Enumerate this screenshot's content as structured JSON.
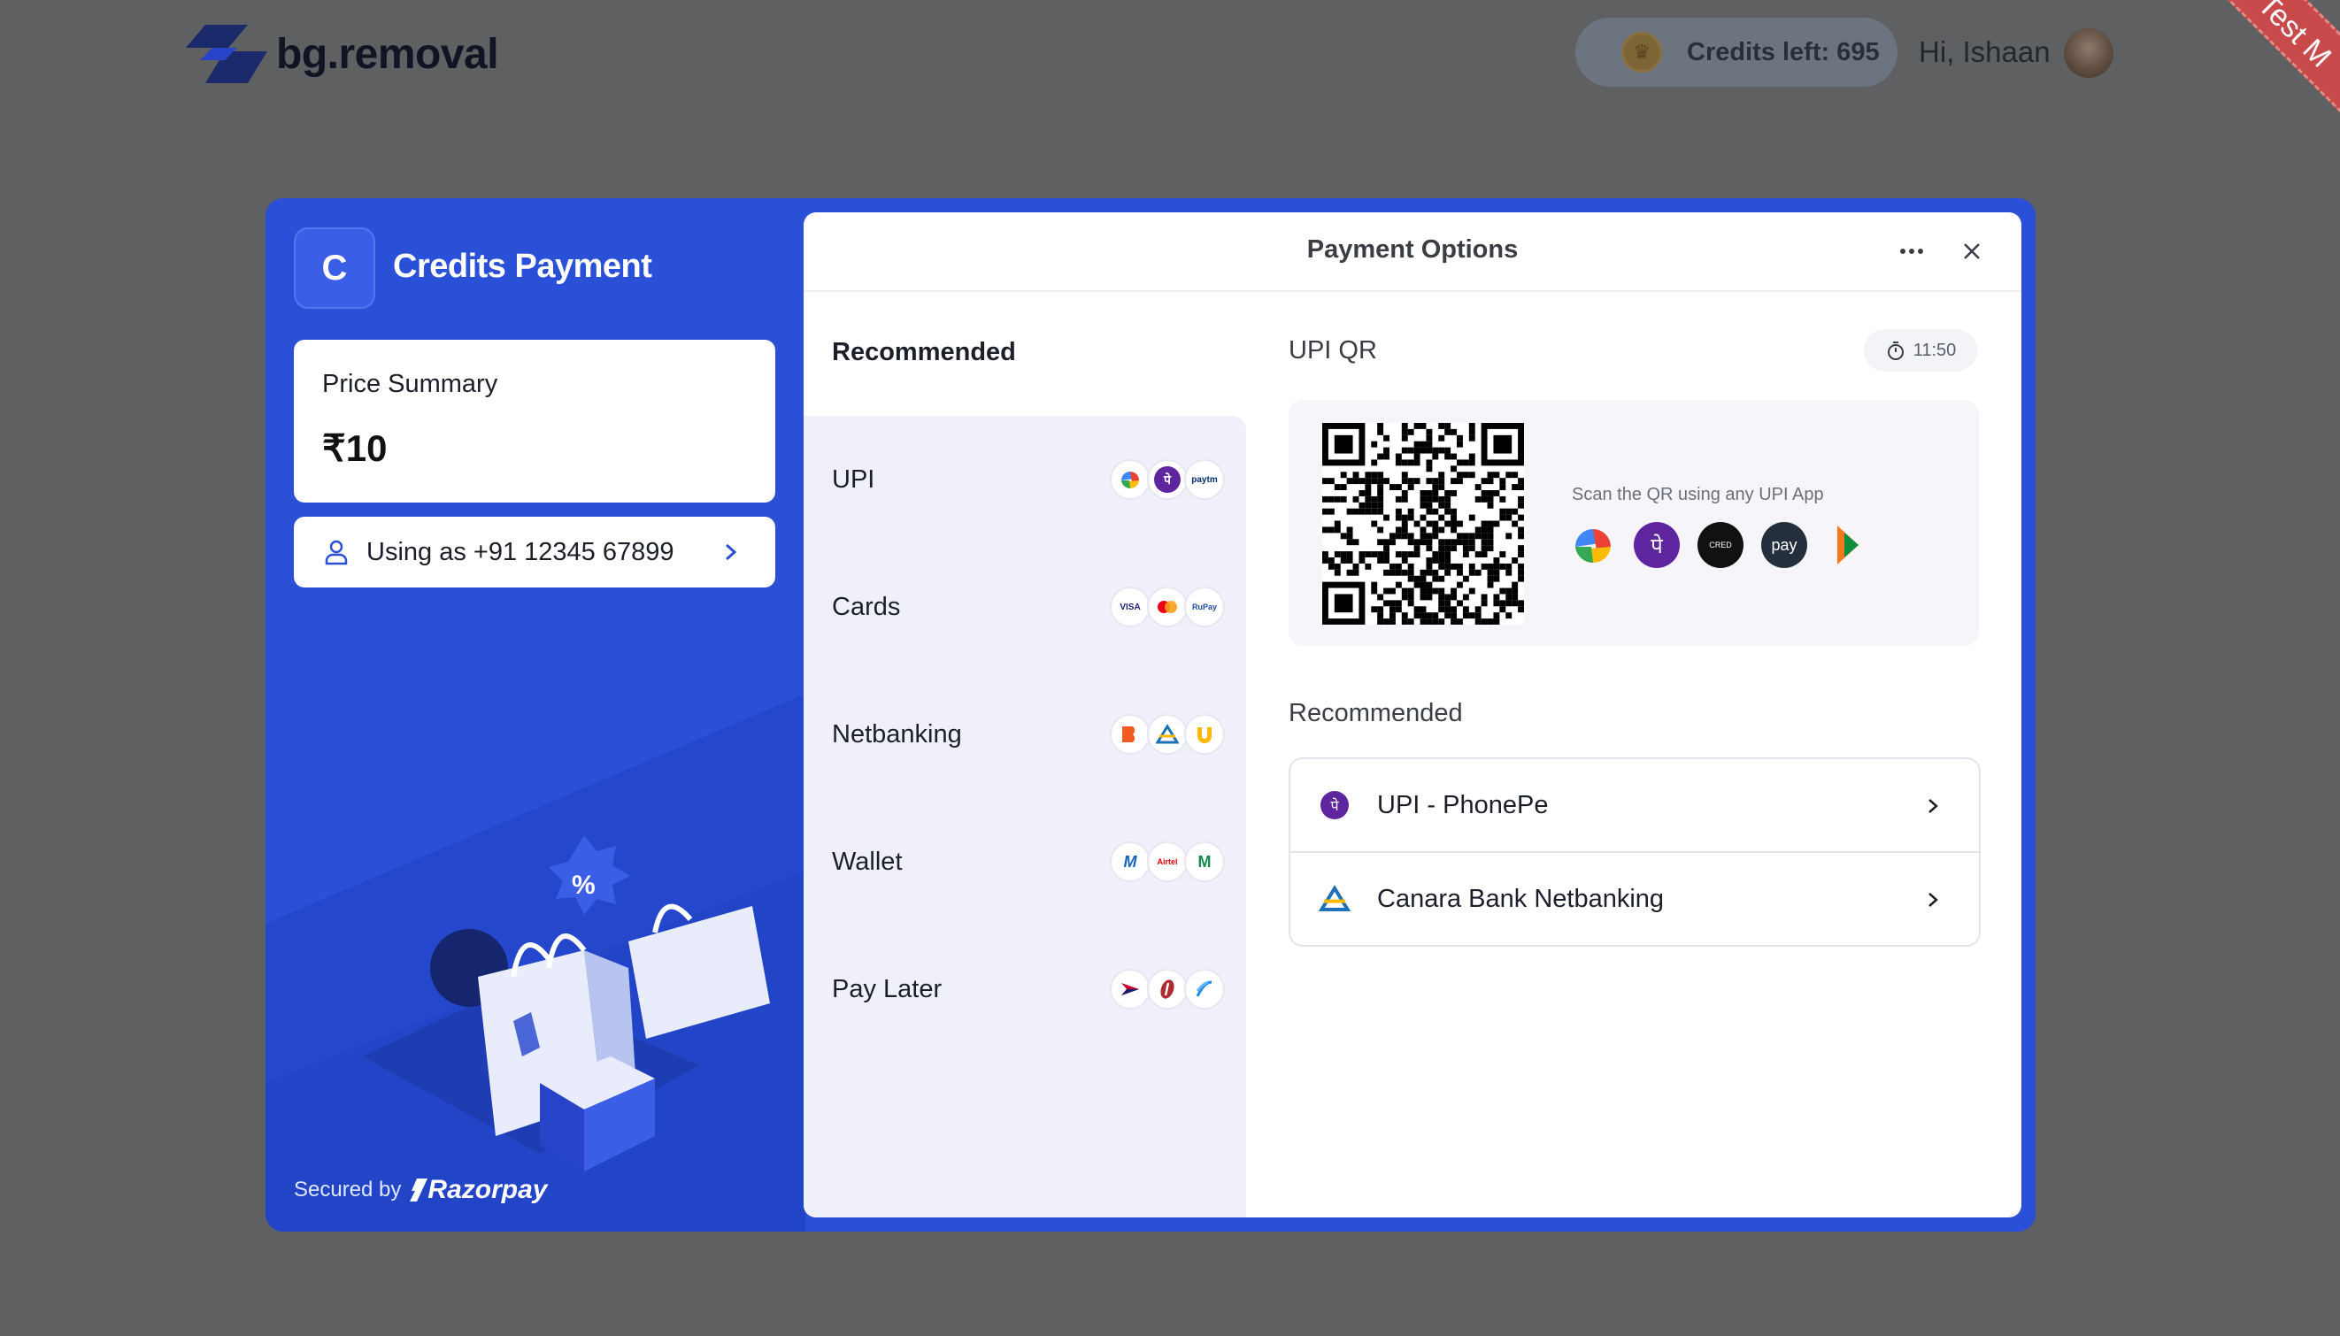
{
  "header": {
    "brand": "bg.removal",
    "credits_label": "Credits left: 695",
    "greeting": "Hi, Ishaan"
  },
  "ribbon": {
    "text": "Test M"
  },
  "modal": {
    "merchant_initial": "C",
    "merchant_name": "Credits Payment",
    "price_summary_label": "Price Summary",
    "price_value": "₹10",
    "contact_text": "Using as +91 12345 67899",
    "secured_by": "Secured by",
    "razorpay": "Razorpay",
    "topbar_title": "Payment Options",
    "methods_heading": "Recommended",
    "methods": [
      {
        "label": "UPI",
        "icons": [
          "google-pay",
          "phonepe",
          "paytm"
        ]
      },
      {
        "label": "Cards",
        "icons": [
          "visa",
          "mastercard",
          "rupay"
        ]
      },
      {
        "label": "Netbanking",
        "icons": [
          "bob",
          "canara",
          "pnb"
        ]
      },
      {
        "label": "Wallet",
        "icons": [
          "mobikwik",
          "airtel",
          "m-wallet"
        ]
      },
      {
        "label": "Pay Later",
        "icons": [
          "lazypay",
          "icici",
          "hdfc"
        ]
      }
    ],
    "upi_qr_title": "UPI QR",
    "timer": "11:50",
    "qr_hint": "Scan the QR using any UPI App",
    "qr_apps": [
      "google-pay",
      "phonepe",
      "cred",
      "amazon-pay",
      "bhim"
    ],
    "qr_app_labels": {
      "phonepe": "पे",
      "cred": "CRED",
      "amazon": "pay"
    },
    "recommended_title": "Recommended",
    "recommended": [
      {
        "label": "UPI - PhonePe",
        "icon": "phonepe"
      },
      {
        "label": "Canara Bank Netbanking",
        "icon": "canara"
      }
    ],
    "method_icon_labels": {
      "phonepe": "पे",
      "paytm": "paytm",
      "visa": "VISA",
      "rupay": "RuPay",
      "mobikwik": "M",
      "airtel": "Airtel",
      "m-wallet": "M"
    }
  },
  "colors": {
    "brand_blue": "#2a50d8",
    "overlay": "#5f6062",
    "phonepe_purple": "#5f259f",
    "ribbon_red": "#c94a4a"
  }
}
